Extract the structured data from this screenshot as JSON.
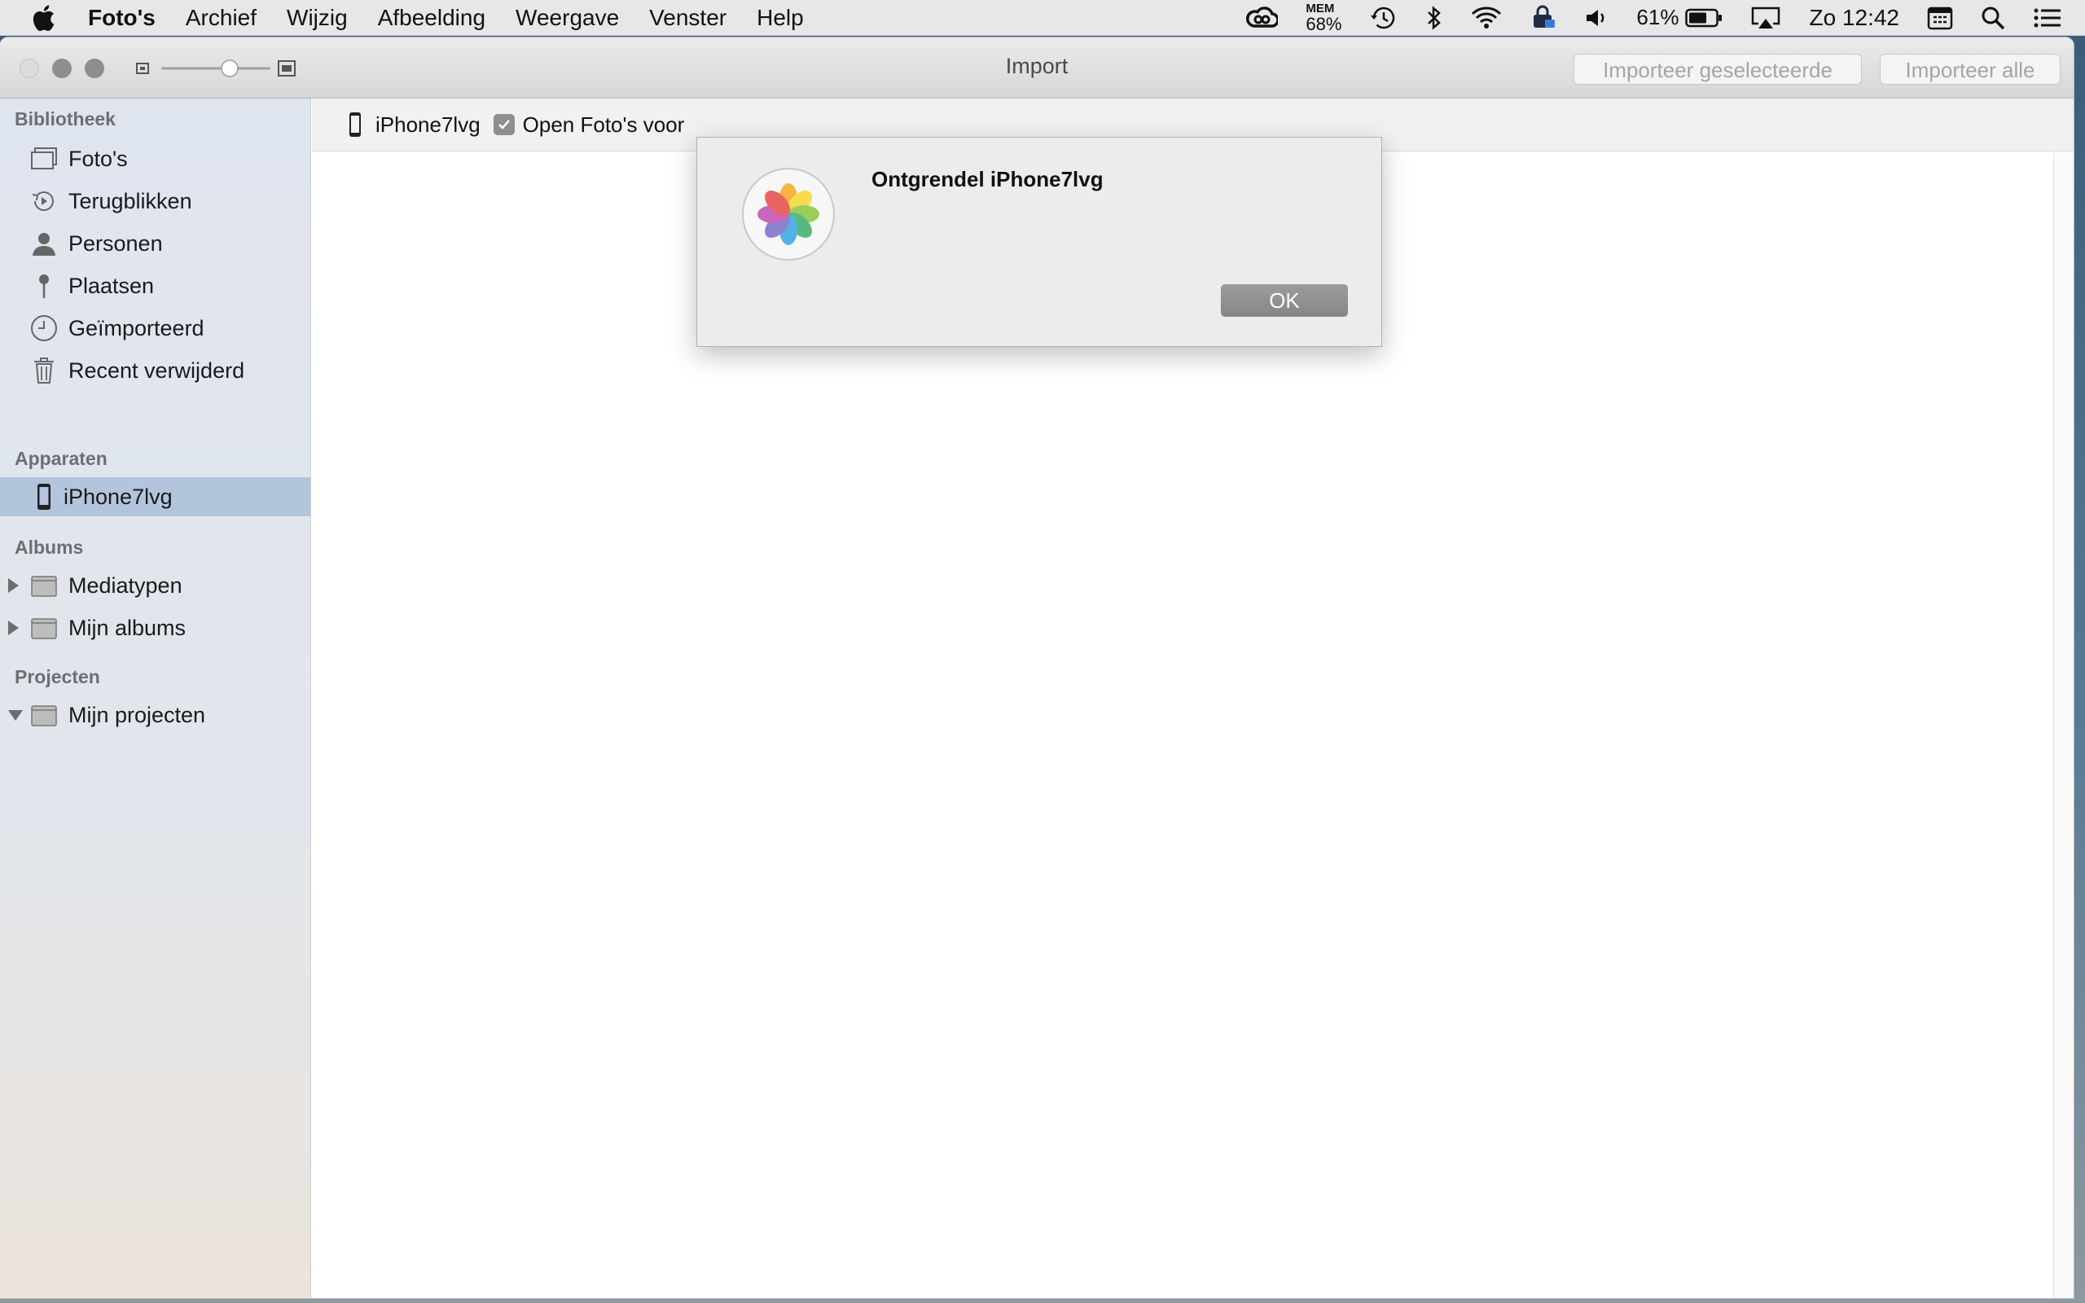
{
  "menubar": {
    "app_name": "Foto's",
    "items": [
      "Archief",
      "Wijzig",
      "Afbeelding",
      "Weergave",
      "Venster",
      "Help"
    ],
    "mem_label": "MEM",
    "mem_value": "68%",
    "battery": "61%",
    "clock": "Zo 12:42"
  },
  "window": {
    "title": "Import",
    "import_selected_label": "Importeer geselecteerde",
    "import_all_label": "Importeer alle"
  },
  "sidebar": {
    "library_header": "Bibliotheek",
    "library_items": [
      "Foto's",
      "Terugblikken",
      "Personen",
      "Plaatsen",
      "Geïmporteerd",
      "Recent verwijderd"
    ],
    "devices_header": "Apparaten",
    "device": "iPhone7lvg",
    "albums_header": "Albums",
    "album_items": [
      "Mediatypen",
      "Mijn albums"
    ],
    "projects_header": "Projecten",
    "project_items": [
      "Mijn projecten"
    ]
  },
  "main": {
    "device_name": "iPhone7lvg",
    "open_photos_label": "Open Foto's voor"
  },
  "dialog": {
    "title": "Ontgrendel iPhone7lvg",
    "ok_label": "OK"
  }
}
